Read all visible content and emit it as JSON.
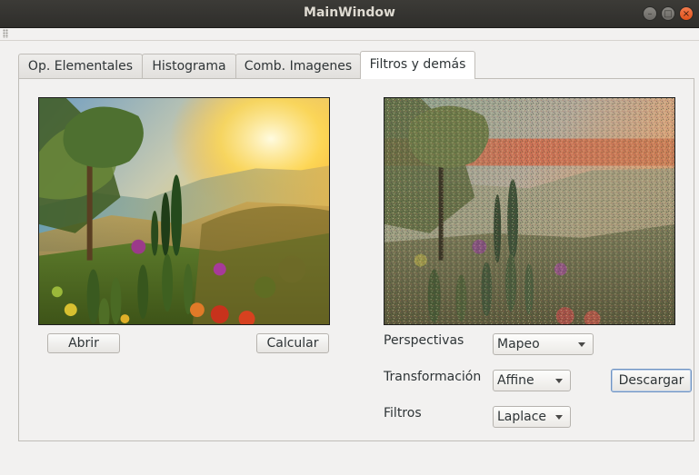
{
  "window": {
    "title": "MainWindow",
    "controls": {
      "minimize_icon": "–",
      "maximize_icon": "□",
      "close_icon": "×"
    }
  },
  "tabs": [
    {
      "label": "Op. Elementales",
      "active": false
    },
    {
      "label": "Histograma",
      "active": false
    },
    {
      "label": "Comb. Imagenes",
      "active": false
    },
    {
      "label": "Filtros y demás",
      "active": true
    }
  ],
  "left_panel": {
    "image": "landscape-original",
    "open_button": "Abrir",
    "calculate_button": "Calcular"
  },
  "right_panel": {
    "image": "landscape-filtered",
    "perspectivas_label": "Perspectivas",
    "perspectivas_value": "Mapeo",
    "transformacion_label": "Transformación",
    "transformacion_value": "Affine",
    "filtros_label": "Filtros",
    "filtros_value": "Laplace",
    "download_button": "Descargar"
  },
  "colors": {
    "titlebar": "#3c3b37",
    "window_bg": "#f2f1f0",
    "close_button": "#e0521b",
    "focus_border": "#6f93c2"
  }
}
